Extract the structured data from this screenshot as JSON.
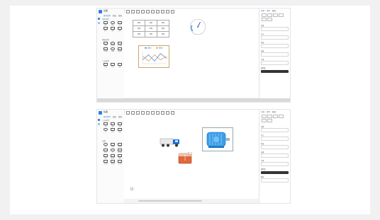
{
  "screens": [
    {
      "app_title": "绘图",
      "sidebar_tabs": [
        "基本组件",
        "图表",
        "图纸"
      ],
      "sidebar_sections": [
        "基本组件",
        "图表组件",
        "工业组件"
      ],
      "sidebar_items": [
        "矩形",
        "圆形",
        "文本",
        "图片",
        "线条",
        "按钮",
        "表格",
        "仪表盘",
        "折线图",
        "柱状图",
        "饼图",
        "面积图",
        "管道",
        "阀门",
        "电机"
      ],
      "props_tabs": [
        "外观",
        "事件",
        "数据"
      ],
      "props_labels": [
        "位置",
        "尺寸",
        "背景",
        "边框",
        "字体",
        "透明度"
      ],
      "table_cells": [
        [
          "数据",
          "数据",
          "数据"
        ],
        [
          "数据",
          "数据",
          "数据"
        ],
        [
          "数据",
          "数据",
          "数据"
        ]
      ],
      "gauge_value": 60,
      "line_series": [
        {
          "name": "系列1",
          "values": [
            3,
            7,
            2,
            8,
            4
          ],
          "color": "#4a90e2"
        },
        {
          "name": "系列2",
          "values": [
            6,
            2,
            7,
            3,
            6
          ],
          "color": "#e0a060"
        }
      ]
    },
    {
      "app_title": "绘图",
      "sidebar_tabs": [
        "基本组件",
        "图表",
        "图纸"
      ],
      "sidebar_sections": [
        "工业组件",
        "设备"
      ],
      "sidebar_items": [
        "卡车",
        "电机",
        "水箱",
        "泵",
        "阀门",
        "管道",
        "风机",
        "储罐",
        "传感器",
        "开关",
        "灯",
        "显示屏",
        "电池",
        "变压器",
        "锅炉",
        "冷却塔",
        "压缩机",
        "过滤器"
      ],
      "props_tabs": [
        "外观",
        "事件",
        "数据"
      ],
      "props_labels": [
        "位置",
        "尺寸",
        "背景",
        "边框",
        "字体",
        "透明度",
        "颜色"
      ]
    }
  ],
  "colors": {
    "accent": "#2f7de1",
    "motor": "#3a9ee8",
    "tank": "#e2683a",
    "truck": "#1f6fd1"
  }
}
